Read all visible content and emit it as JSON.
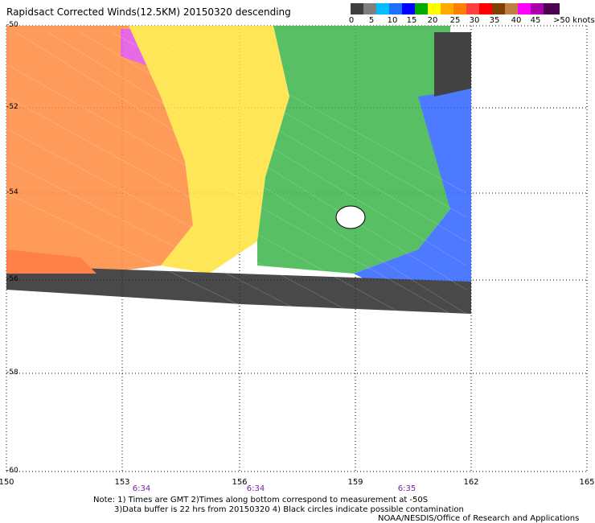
{
  "title": "Rapidsact Corrected Winds(12.5KM) 20150320 descending",
  "legend": {
    "colors": [
      "#3f3f3f",
      "#7f7f7f",
      "#00bfff",
      "#1f6fff",
      "#0000ff",
      "#00aa00",
      "#ffff00",
      "#ffaa00",
      "#ff7f00",
      "#ff3f3f",
      "#ff0000",
      "#7f3f00",
      "#bf7f3f",
      "#ff00ff",
      "#aa00aa",
      "#4f004f"
    ],
    "labels": [
      "0",
      "5",
      "10",
      "15",
      "20",
      "25",
      "30",
      "35",
      "40",
      "45"
    ],
    "unit_label": ">50 knots"
  },
  "axes": {
    "lon_labels": [
      "150",
      "153",
      "156",
      "159",
      "162",
      "165"
    ],
    "lat_labels": [
      "-50",
      "-52",
      "-54",
      "-56",
      "-58",
      "-60"
    ]
  },
  "times": [
    "6:34",
    "6:34",
    "6:35"
  ],
  "notes": {
    "line1": "Note: 1) Times are GMT 2)Times along bottom correspond to measurement at -50S",
    "line2": "3)Data buffer is 22 hrs from 20150320 4) Black circles indicate possible contamination",
    "line3": "NOAA/NESDIS/Office of Research and Applications"
  }
}
